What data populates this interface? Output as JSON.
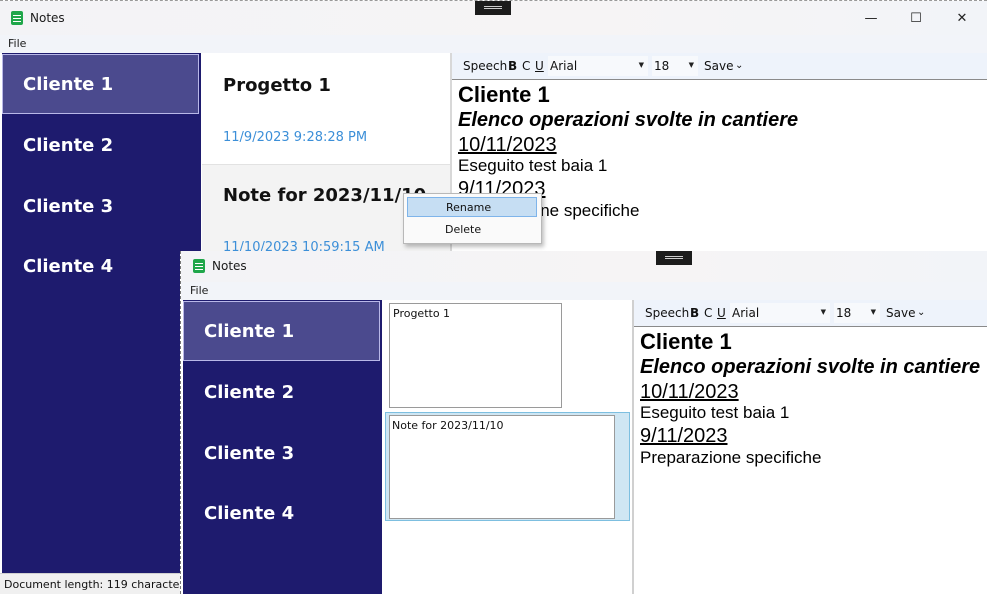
{
  "app": {
    "title": "Notes",
    "menu_file": "File"
  },
  "window_controls": {
    "minimize": "—",
    "maximize": "☐",
    "close": "✕"
  },
  "clients": [
    "Cliente 1",
    "Cliente 2",
    "Cliente 3",
    "Cliente 4"
  ],
  "back_window": {
    "notes": [
      {
        "title": "Progetto 1",
        "date": "11/9/2023 9:28:28 PM"
      },
      {
        "title": "Note for 2023/11/10",
        "date": "11/10/2023 10:59:15 AM"
      }
    ],
    "status": "Document length: 119 characters"
  },
  "context_menu": {
    "items": [
      "Rename",
      "Delete"
    ]
  },
  "front_window": {
    "notes": [
      {
        "title": "Progetto 1"
      },
      {
        "title": "Note for 2023/11/10"
      }
    ]
  },
  "toolbar": {
    "speech": "Speech",
    "bold": "B",
    "color": "C",
    "underline": "U",
    "font": "Arial",
    "size": "18",
    "save": "Save",
    "overflow": "⌄"
  },
  "editor": {
    "title": "Cliente 1",
    "subtitle": "Elenco operazioni svolte in cantiere",
    "date1": "10/11/2023",
    "line1": "Eseguito test baia 1",
    "date2": "9/11/2023",
    "line2": "Preparazione specifiche"
  },
  "colors": {
    "sidebar": "#1e1b6e",
    "sidebar_selected": "#4b4a8e",
    "date_text": "#3c8fd8",
    "note_selected": "#cfe6f3",
    "app_icon": "#1fa64a"
  }
}
